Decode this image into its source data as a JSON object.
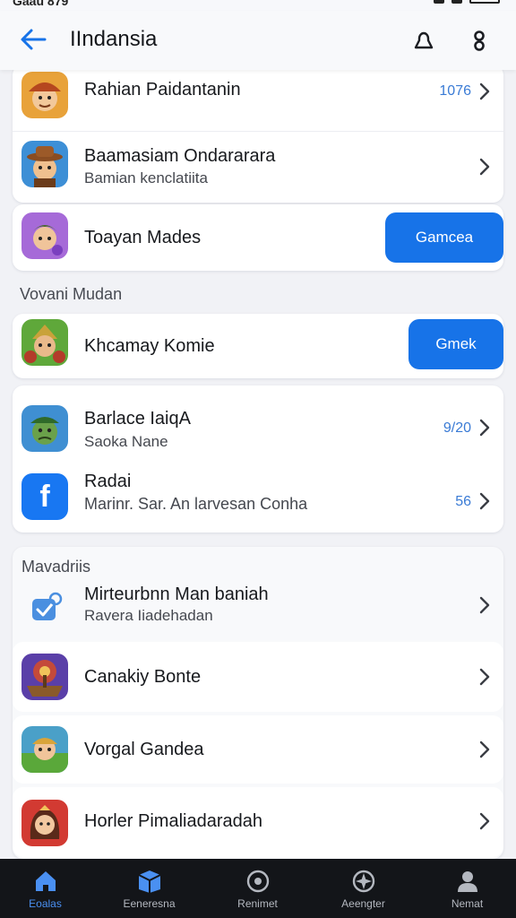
{
  "status_bar": {
    "time": "Gaau 879"
  },
  "header": {
    "title": "IIndansia"
  },
  "colors": {
    "accent": "#1773e8",
    "tabbar_bg": "#131519",
    "active_tab": "#4a90f2"
  },
  "group1": [
    {
      "title": "Rahian Paidantanin",
      "meta": "1076",
      "icon": "warrior-avatar-icon"
    },
    {
      "title": "Baamasiam Ondararara",
      "subtitle": "Bamian kenclatiita",
      "icon": "cowboy-avatar-icon"
    }
  ],
  "item_toayan": {
    "title": "Toayan Mades",
    "button": "Gamcea",
    "icon": "elf-avatar-icon"
  },
  "section1": {
    "title": "Vovani Mudan"
  },
  "item_khamay": {
    "title": "Khcamay Komie",
    "button": "Gmek",
    "icon": "knight-avatar-icon"
  },
  "group2": [
    {
      "title": "Barlace IaiqA",
      "subtitle": "Saoka Nane",
      "meta": "9/20",
      "icon": "orc-avatar-icon"
    },
    {
      "title": "Radai",
      "subtitle": "Marinr. Sar. An larvesan Conha",
      "meta": "56",
      "icon": "facebook-icon",
      "glyph": "f"
    }
  ],
  "section2": {
    "title": "Mavadriis"
  },
  "group3": [
    {
      "title": "Mirteurbnn Man baniah",
      "subtitle": "Ravera Iiadehadan",
      "icon": "verified-check-icon"
    },
    {
      "title": "Canakiy Bonte",
      "icon": "pirate-ship-icon"
    },
    {
      "title": "Vorgal Gandea",
      "icon": "adventurer-avatar-icon"
    },
    {
      "title": "Horler Pimaliadaradah",
      "icon": "princess-avatar-icon"
    }
  ],
  "tabs": [
    {
      "label": "Eoalas",
      "icon": "home-icon",
      "active": true
    },
    {
      "label": "Eeneresna",
      "icon": "box-icon",
      "active": false
    },
    {
      "label": "Renimet",
      "icon": "record-icon",
      "active": false
    },
    {
      "label": "Aeengter",
      "icon": "compass-icon",
      "active": false
    },
    {
      "label": "Nemat",
      "icon": "profile-icon",
      "active": false
    }
  ]
}
